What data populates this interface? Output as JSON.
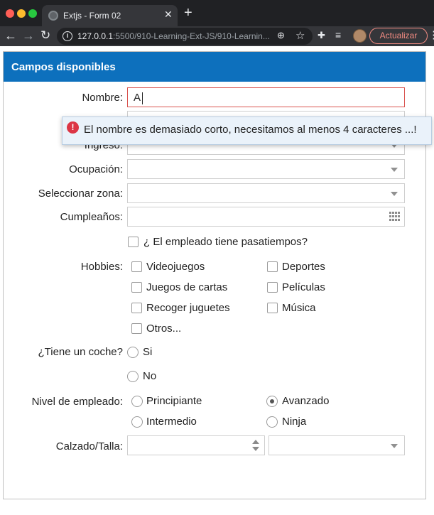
{
  "browser": {
    "tab_title": "Extjs - Form 02",
    "url_host": "127.0.0.1",
    "url_path": ":5500/910-Learning-Ext-JS/910-Learnin...",
    "update_label": "Actualizar"
  },
  "panel": {
    "title": "Campos disponibles"
  },
  "fields": {
    "nombre_label": "Nombre:",
    "nombre_value": "A",
    "ingreso_label": "Ingreso:",
    "ocupacion_label": "Ocupación:",
    "zona_label": "Seleccionar zona:",
    "cumpleanos_label": "Cumpleaños:",
    "pasatiempos_label": "¿ El empleado tiene pasatiempos?",
    "hobbies_label": "Hobbies:",
    "coche_label": "¿Tiene un coche?",
    "nivel_label": "Nivel de empleado:",
    "calzado_label": "Calzado/Talla:"
  },
  "hobbies": [
    "Videojuegos",
    "Deportes",
    "Juegos de cartas",
    "Películas",
    "Recoger juguetes",
    "Música",
    "Otros..."
  ],
  "coche_options": [
    "Si",
    "No"
  ],
  "nivel_options": [
    "Principiante",
    "Avanzado",
    "Intermedio",
    "Ninja"
  ],
  "nivel_selected": "Avanzado",
  "error_tooltip": "El nombre es demasiado corto, necesitamos al menos 4 caracteres ...!"
}
